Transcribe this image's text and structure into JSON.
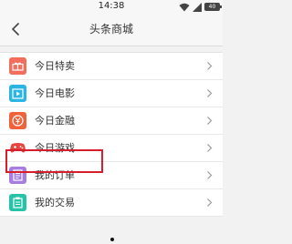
{
  "status_bar": {
    "time": "14:38",
    "battery": "40"
  },
  "header": {
    "title": "头条商城"
  },
  "menu": {
    "items": [
      {
        "label": "今日特卖",
        "icon": "sale-tag-icon",
        "color": "#f26d5b"
      },
      {
        "label": "今日电影",
        "icon": "film-icon",
        "color": "#2bb5e2"
      },
      {
        "label": "今日金融",
        "icon": "yen-icon",
        "color": "#f2623a"
      },
      {
        "label": "今日游戏",
        "icon": "gamepad-icon",
        "color": "#e8433f"
      },
      {
        "label": "我的订单",
        "icon": "order-list-icon",
        "color": "#a77ee0"
      },
      {
        "label": "我的交易",
        "icon": "trade-clipboard-icon",
        "color": "#27c3a8"
      }
    ]
  },
  "highlight": {
    "color": "#d81e2a",
    "target": "今日游戏"
  }
}
